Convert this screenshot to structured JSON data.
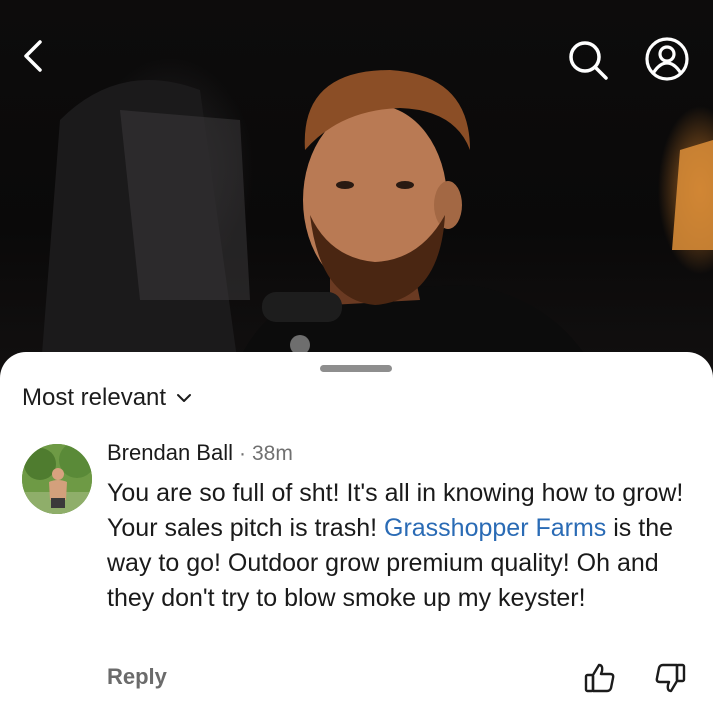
{
  "video": {
    "icons": {
      "back": "chevron-left-icon",
      "search": "search-icon",
      "profile": "account-circle-icon"
    }
  },
  "sheet": {
    "sort_label": "Most relevant",
    "sort_icon": "chevron-down-icon"
  },
  "comment": {
    "author": "Brendan Ball",
    "separator": "·",
    "time": "38m",
    "text_before_link": "You are so full of sht! It's all in knowing how to grow! Your sales pitch is trash! ",
    "link_text": "Grasshopper Farms",
    "text_after_link": " is the way to go! Outdoor grow premium quality! Oh and they don't try to blow smoke up my keyster!",
    "reply_label": "Reply",
    "link_color": "#2a6bb5"
  }
}
